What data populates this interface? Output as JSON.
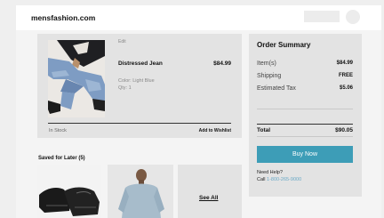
{
  "site": {
    "name": "mensfashion.com"
  },
  "cart": {
    "item": {
      "edit_label": "Edit",
      "name": "Distressed Jean",
      "price": "$84.99",
      "color_label": "Color: Light Blue",
      "qty_label": "Qty: 1",
      "stock_status": "In Stock",
      "wishlist_label": "Add to Wishlist"
    }
  },
  "saved": {
    "title": "Saved for Later (5)",
    "see_all_label": "See All"
  },
  "summary": {
    "title": "Order Summary",
    "rows": [
      {
        "label": "Item(s)",
        "value": "$84.99"
      },
      {
        "label": "Shipping",
        "value": "FREE"
      },
      {
        "label": "Estimated Tax",
        "value": "$5.06"
      }
    ],
    "total_label": "Total",
    "total_value": "$90.05",
    "buy_label": "Buy Now",
    "help_label": "Need Help?",
    "call_label": "Call",
    "phone": "1-800-265-9000"
  },
  "colors": {
    "accent": "#3d9db7",
    "link": "#6aa9c6"
  }
}
